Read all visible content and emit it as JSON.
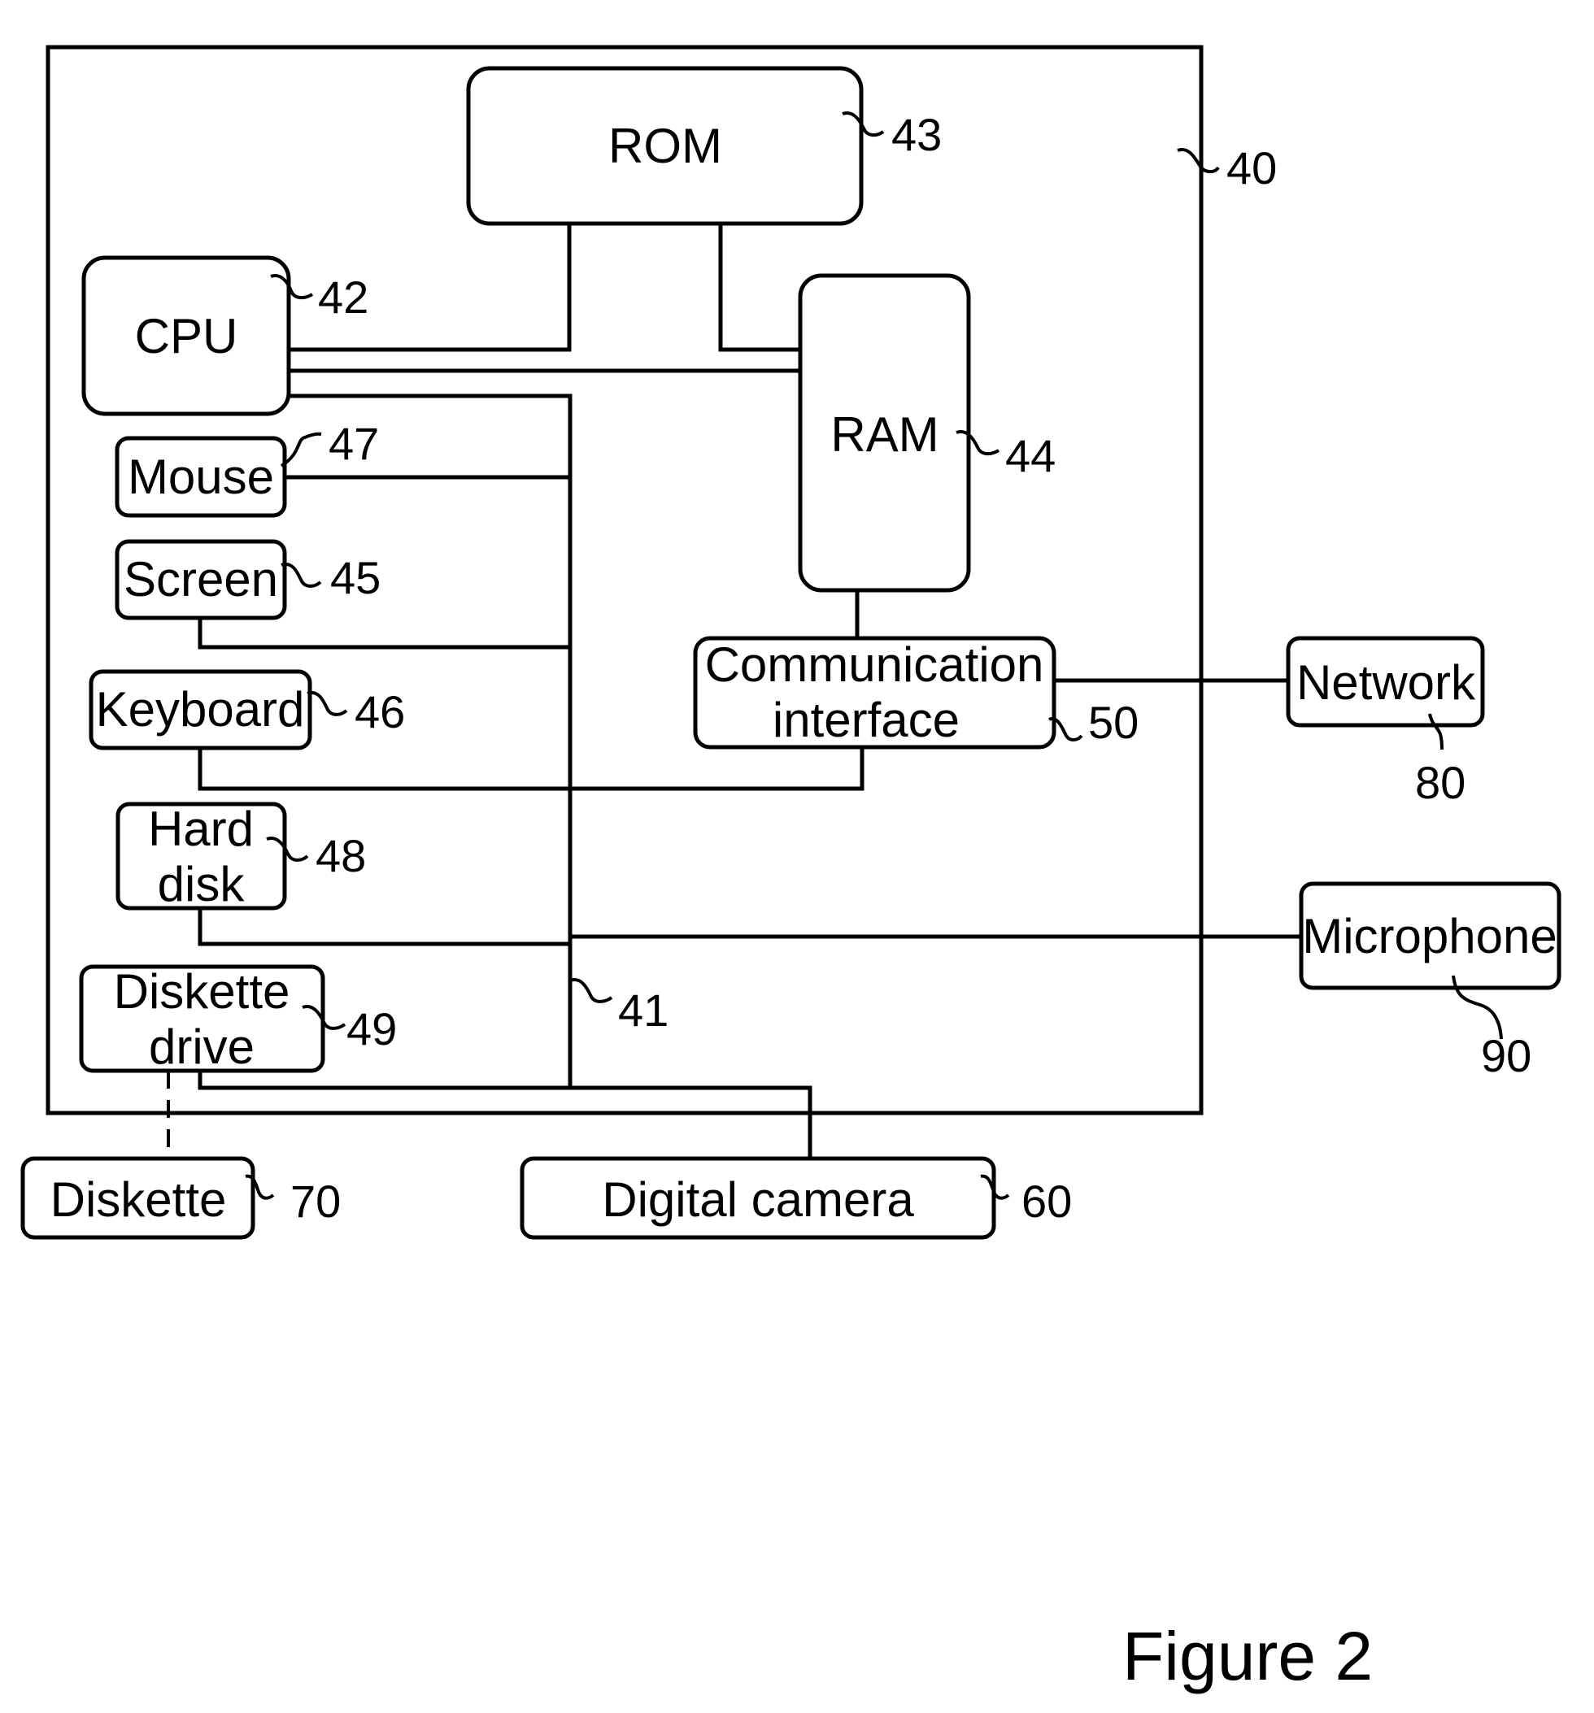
{
  "figure": {
    "caption": "Figure 2",
    "system": {
      "ref": "40"
    },
    "bus": {
      "ref": "41"
    },
    "components": {
      "cpu": {
        "label": "CPU",
        "ref": "42"
      },
      "rom": {
        "label": "ROM",
        "ref": "43"
      },
      "ram": {
        "label": "RAM",
        "ref": "44"
      },
      "screen": {
        "label": "Screen",
        "ref": "45"
      },
      "keyboard": {
        "label": "Keyboard",
        "ref": "46"
      },
      "mouse": {
        "label": "Mouse",
        "ref": "47"
      },
      "hard_disk": {
        "label_line1": "Hard",
        "label_line2": "disk",
        "ref": "48"
      },
      "diskette_drive": {
        "label_line1": "Diskette",
        "label_line2": "drive",
        "ref": "49"
      },
      "comm_interface": {
        "label_line1": "Communication",
        "label_line2": "interface",
        "ref": "50"
      },
      "digital_camera": {
        "label": "Digital camera",
        "ref": "60"
      },
      "diskette": {
        "label": "Diskette",
        "ref": "70"
      },
      "network": {
        "label": "Network",
        "ref": "80"
      },
      "microphone": {
        "label": "Microphone",
        "ref": "90"
      }
    }
  }
}
